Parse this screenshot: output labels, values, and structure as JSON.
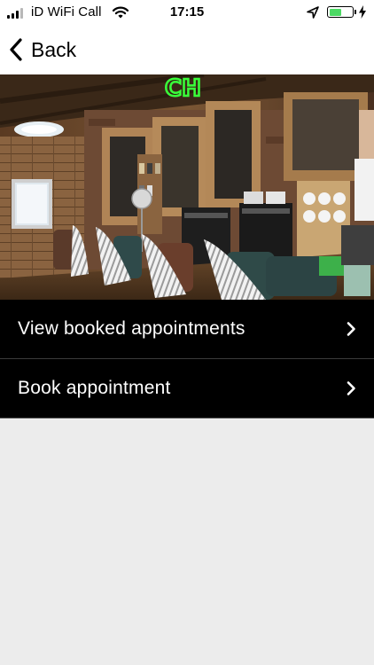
{
  "status_bar": {
    "carrier": "iD WiFi Call",
    "time": "17:15",
    "battery_percent": 60,
    "battery_color": "#4cd964"
  },
  "nav": {
    "back_label": "Back"
  },
  "hero": {
    "image_description": "barbershop-interior-photo",
    "neon_text": "CH"
  },
  "menu": {
    "items": [
      {
        "label": "View booked appointments",
        "icon": "chevron-right-icon"
      },
      {
        "label": "Book appointment",
        "icon": "chevron-right-icon"
      }
    ]
  },
  "colors": {
    "menu_background": "#000000",
    "menu_text": "#ffffff",
    "page_background": "#ececec"
  }
}
